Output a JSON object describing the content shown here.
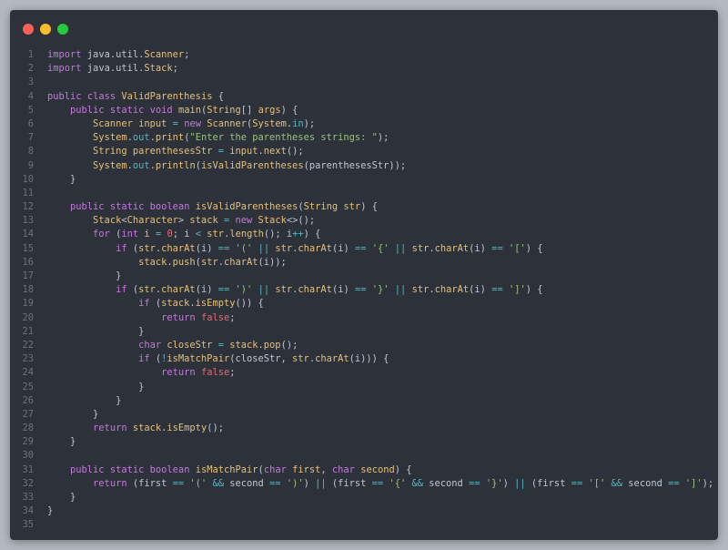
{
  "window": {
    "controls": [
      {
        "name": "close",
        "color": "#ff5f56"
      },
      {
        "name": "minimize",
        "color": "#ffbd2e"
      },
      {
        "name": "maximize",
        "color": "#27c93f"
      }
    ]
  },
  "code": {
    "lines": [
      [
        [
          "k",
          "import"
        ],
        [
          "p",
          " java.util."
        ],
        [
          "t",
          "Scanner"
        ],
        [
          "p",
          ";"
        ]
      ],
      [
        [
          "k",
          "import"
        ],
        [
          "p",
          " java.util."
        ],
        [
          "t",
          "Stack"
        ],
        [
          "p",
          ";"
        ]
      ],
      [],
      [
        [
          "k",
          "public"
        ],
        [
          "p",
          " "
        ],
        [
          "k",
          "class"
        ],
        [
          "p",
          " "
        ],
        [
          "f",
          "ValidParenthesis"
        ],
        [
          "p",
          " {"
        ]
      ],
      [
        [
          "p",
          "    "
        ],
        [
          "k",
          "public"
        ],
        [
          "p",
          " "
        ],
        [
          "k",
          "static"
        ],
        [
          "p",
          " "
        ],
        [
          "k",
          "void"
        ],
        [
          "p",
          " "
        ],
        [
          "f",
          "main"
        ],
        [
          "p",
          "("
        ],
        [
          "t",
          "String"
        ],
        [
          "p",
          "[] "
        ],
        [
          "c",
          "args"
        ],
        [
          "p",
          ") {"
        ]
      ],
      [
        [
          "p",
          "        "
        ],
        [
          "t",
          "Scanner"
        ],
        [
          "p",
          " "
        ],
        [
          "c",
          "input"
        ],
        [
          "p",
          " "
        ],
        [
          "o",
          "="
        ],
        [
          "p",
          " "
        ],
        [
          "k",
          "new"
        ],
        [
          "p",
          " "
        ],
        [
          "f",
          "Scanner"
        ],
        [
          "p",
          "("
        ],
        [
          "t",
          "System"
        ],
        [
          "p",
          "."
        ],
        [
          "x",
          "in"
        ],
        [
          "p",
          ");"
        ]
      ],
      [
        [
          "p",
          "        "
        ],
        [
          "t",
          "System"
        ],
        [
          "p",
          "."
        ],
        [
          "x",
          "out"
        ],
        [
          "p",
          "."
        ],
        [
          "f",
          "print"
        ],
        [
          "p",
          "("
        ],
        [
          "s",
          "\"Enter the parentheses strings: \""
        ],
        [
          "p",
          ");"
        ]
      ],
      [
        [
          "p",
          "        "
        ],
        [
          "t",
          "String"
        ],
        [
          "p",
          " "
        ],
        [
          "c",
          "parenthesesStr"
        ],
        [
          "p",
          " "
        ],
        [
          "o",
          "="
        ],
        [
          "p",
          " "
        ],
        [
          "c",
          "input"
        ],
        [
          "p",
          "."
        ],
        [
          "f",
          "next"
        ],
        [
          "p",
          "();"
        ]
      ],
      [
        [
          "p",
          "        "
        ],
        [
          "t",
          "System"
        ],
        [
          "p",
          "."
        ],
        [
          "x",
          "out"
        ],
        [
          "p",
          "."
        ],
        [
          "f",
          "println"
        ],
        [
          "p",
          "("
        ],
        [
          "f",
          "isValidParentheses"
        ],
        [
          "p",
          "(parenthesesStr));"
        ]
      ],
      [
        [
          "p",
          "    }"
        ]
      ],
      [],
      [
        [
          "p",
          "    "
        ],
        [
          "k",
          "public"
        ],
        [
          "p",
          " "
        ],
        [
          "k",
          "static"
        ],
        [
          "p",
          " "
        ],
        [
          "k",
          "boolean"
        ],
        [
          "p",
          " "
        ],
        [
          "f",
          "isValidParentheses"
        ],
        [
          "p",
          "("
        ],
        [
          "t",
          "String"
        ],
        [
          "p",
          " "
        ],
        [
          "c",
          "str"
        ],
        [
          "p",
          ") {"
        ]
      ],
      [
        [
          "p",
          "        "
        ],
        [
          "t",
          "Stack"
        ],
        [
          "p",
          "<"
        ],
        [
          "t",
          "Character"
        ],
        [
          "p",
          "> "
        ],
        [
          "c",
          "stack"
        ],
        [
          "p",
          " "
        ],
        [
          "o",
          "="
        ],
        [
          "p",
          " "
        ],
        [
          "k",
          "new"
        ],
        [
          "p",
          " "
        ],
        [
          "t",
          "Stack"
        ],
        [
          "p",
          "<>();"
        ]
      ],
      [
        [
          "p",
          "        "
        ],
        [
          "k",
          "for"
        ],
        [
          "p",
          " ("
        ],
        [
          "k",
          "int"
        ],
        [
          "p",
          " "
        ],
        [
          "c",
          "i"
        ],
        [
          "p",
          " "
        ],
        [
          "o",
          "="
        ],
        [
          "p",
          " "
        ],
        [
          "n",
          "0"
        ],
        [
          "p",
          "; i "
        ],
        [
          "o",
          "<"
        ],
        [
          "p",
          " "
        ],
        [
          "c",
          "str"
        ],
        [
          "p",
          "."
        ],
        [
          "f",
          "length"
        ],
        [
          "p",
          "(); i"
        ],
        [
          "o",
          "++"
        ],
        [
          "p",
          ") {"
        ]
      ],
      [
        [
          "p",
          "            "
        ],
        [
          "k",
          "if"
        ],
        [
          "p",
          " ("
        ],
        [
          "c",
          "str"
        ],
        [
          "p",
          "."
        ],
        [
          "f",
          "charAt"
        ],
        [
          "p",
          "(i) "
        ],
        [
          "o",
          "=="
        ],
        [
          "p",
          " "
        ],
        [
          "s",
          "'('"
        ],
        [
          "p",
          " "
        ],
        [
          "o",
          "||"
        ],
        [
          "p",
          " "
        ],
        [
          "c",
          "str"
        ],
        [
          "p",
          "."
        ],
        [
          "f",
          "charAt"
        ],
        [
          "p",
          "(i) "
        ],
        [
          "o",
          "=="
        ],
        [
          "p",
          " "
        ],
        [
          "s",
          "'{'"
        ],
        [
          "p",
          " "
        ],
        [
          "o",
          "||"
        ],
        [
          "p",
          " "
        ],
        [
          "c",
          "str"
        ],
        [
          "p",
          "."
        ],
        [
          "f",
          "charAt"
        ],
        [
          "p",
          "(i) "
        ],
        [
          "o",
          "=="
        ],
        [
          "p",
          " "
        ],
        [
          "s",
          "'['"
        ],
        [
          "p",
          ") {"
        ]
      ],
      [
        [
          "p",
          "                "
        ],
        [
          "c",
          "stack"
        ],
        [
          "p",
          "."
        ],
        [
          "f",
          "push"
        ],
        [
          "p",
          "("
        ],
        [
          "c",
          "str"
        ],
        [
          "p",
          "."
        ],
        [
          "f",
          "charAt"
        ],
        [
          "p",
          "(i));"
        ]
      ],
      [
        [
          "p",
          "            }"
        ]
      ],
      [
        [
          "p",
          "            "
        ],
        [
          "k",
          "if"
        ],
        [
          "p",
          " ("
        ],
        [
          "c",
          "str"
        ],
        [
          "p",
          "."
        ],
        [
          "f",
          "charAt"
        ],
        [
          "p",
          "(i) "
        ],
        [
          "o",
          "=="
        ],
        [
          "p",
          " "
        ],
        [
          "s",
          "')'"
        ],
        [
          "p",
          " "
        ],
        [
          "o",
          "||"
        ],
        [
          "p",
          " "
        ],
        [
          "c",
          "str"
        ],
        [
          "p",
          "."
        ],
        [
          "f",
          "charAt"
        ],
        [
          "p",
          "(i) "
        ],
        [
          "o",
          "=="
        ],
        [
          "p",
          " "
        ],
        [
          "s",
          "'}'"
        ],
        [
          "p",
          " "
        ],
        [
          "o",
          "||"
        ],
        [
          "p",
          " "
        ],
        [
          "c",
          "str"
        ],
        [
          "p",
          "."
        ],
        [
          "f",
          "charAt"
        ],
        [
          "p",
          "(i) "
        ],
        [
          "o",
          "=="
        ],
        [
          "p",
          " "
        ],
        [
          "s",
          "']'"
        ],
        [
          "p",
          ") {"
        ]
      ],
      [
        [
          "p",
          "                "
        ],
        [
          "k",
          "if"
        ],
        [
          "p",
          " ("
        ],
        [
          "c",
          "stack"
        ],
        [
          "p",
          "."
        ],
        [
          "f",
          "isEmpty"
        ],
        [
          "p",
          "()) {"
        ]
      ],
      [
        [
          "p",
          "                    "
        ],
        [
          "k",
          "return"
        ],
        [
          "p",
          " "
        ],
        [
          "r",
          "false"
        ],
        [
          "p",
          ";"
        ]
      ],
      [
        [
          "p",
          "                }"
        ]
      ],
      [
        [
          "p",
          "                "
        ],
        [
          "k",
          "char"
        ],
        [
          "p",
          " "
        ],
        [
          "c",
          "closeStr"
        ],
        [
          "p",
          " "
        ],
        [
          "o",
          "="
        ],
        [
          "p",
          " "
        ],
        [
          "c",
          "stack"
        ],
        [
          "p",
          "."
        ],
        [
          "f",
          "pop"
        ],
        [
          "p",
          "();"
        ]
      ],
      [
        [
          "p",
          "                "
        ],
        [
          "k",
          "if"
        ],
        [
          "p",
          " ("
        ],
        [
          "o",
          "!"
        ],
        [
          "f",
          "isMatchPair"
        ],
        [
          "p",
          "(closeStr, "
        ],
        [
          "c",
          "str"
        ],
        [
          "p",
          "."
        ],
        [
          "f",
          "charAt"
        ],
        [
          "p",
          "(i))) {"
        ]
      ],
      [
        [
          "p",
          "                    "
        ],
        [
          "k",
          "return"
        ],
        [
          "p",
          " "
        ],
        [
          "r",
          "false"
        ],
        [
          "p",
          ";"
        ]
      ],
      [
        [
          "p",
          "                }"
        ]
      ],
      [
        [
          "p",
          "            }"
        ]
      ],
      [
        [
          "p",
          "        }"
        ]
      ],
      [
        [
          "p",
          "        "
        ],
        [
          "k",
          "return"
        ],
        [
          "p",
          " "
        ],
        [
          "c",
          "stack"
        ],
        [
          "p",
          "."
        ],
        [
          "f",
          "isEmpty"
        ],
        [
          "p",
          "();"
        ]
      ],
      [
        [
          "p",
          "    }"
        ]
      ],
      [],
      [
        [
          "p",
          "    "
        ],
        [
          "k",
          "public"
        ],
        [
          "p",
          " "
        ],
        [
          "k",
          "static"
        ],
        [
          "p",
          " "
        ],
        [
          "k",
          "boolean"
        ],
        [
          "p",
          " "
        ],
        [
          "f",
          "isMatchPair"
        ],
        [
          "p",
          "("
        ],
        [
          "k",
          "char"
        ],
        [
          "p",
          " "
        ],
        [
          "c",
          "first"
        ],
        [
          "p",
          ", "
        ],
        [
          "k",
          "char"
        ],
        [
          "p",
          " "
        ],
        [
          "c",
          "second"
        ],
        [
          "p",
          ") {"
        ]
      ],
      [
        [
          "p",
          "        "
        ],
        [
          "k",
          "return"
        ],
        [
          "p",
          " (first "
        ],
        [
          "o",
          "=="
        ],
        [
          "p",
          " "
        ],
        [
          "s",
          "'('"
        ],
        [
          "p",
          " "
        ],
        [
          "o",
          "&&"
        ],
        [
          "p",
          " second "
        ],
        [
          "o",
          "=="
        ],
        [
          "p",
          " "
        ],
        [
          "s",
          "')'"
        ],
        [
          "p",
          ") "
        ],
        [
          "o",
          "||"
        ],
        [
          "p",
          " (first "
        ],
        [
          "o",
          "=="
        ],
        [
          "p",
          " "
        ],
        [
          "s",
          "'{'"
        ],
        [
          "p",
          " "
        ],
        [
          "o",
          "&&"
        ],
        [
          "p",
          " second "
        ],
        [
          "o",
          "=="
        ],
        [
          "p",
          " "
        ],
        [
          "s",
          "'}'"
        ],
        [
          "p",
          ") "
        ],
        [
          "o",
          "||"
        ],
        [
          "p",
          " (first "
        ],
        [
          "o",
          "=="
        ],
        [
          "p",
          " "
        ],
        [
          "s",
          "'['"
        ],
        [
          "p",
          " "
        ],
        [
          "o",
          "&&"
        ],
        [
          "p",
          " second "
        ],
        [
          "o",
          "=="
        ],
        [
          "p",
          " "
        ],
        [
          "s",
          "']'"
        ],
        [
          "p",
          ");"
        ]
      ],
      [
        [
          "p",
          "    }"
        ]
      ],
      [
        [
          "p",
          "}"
        ]
      ],
      []
    ]
  }
}
